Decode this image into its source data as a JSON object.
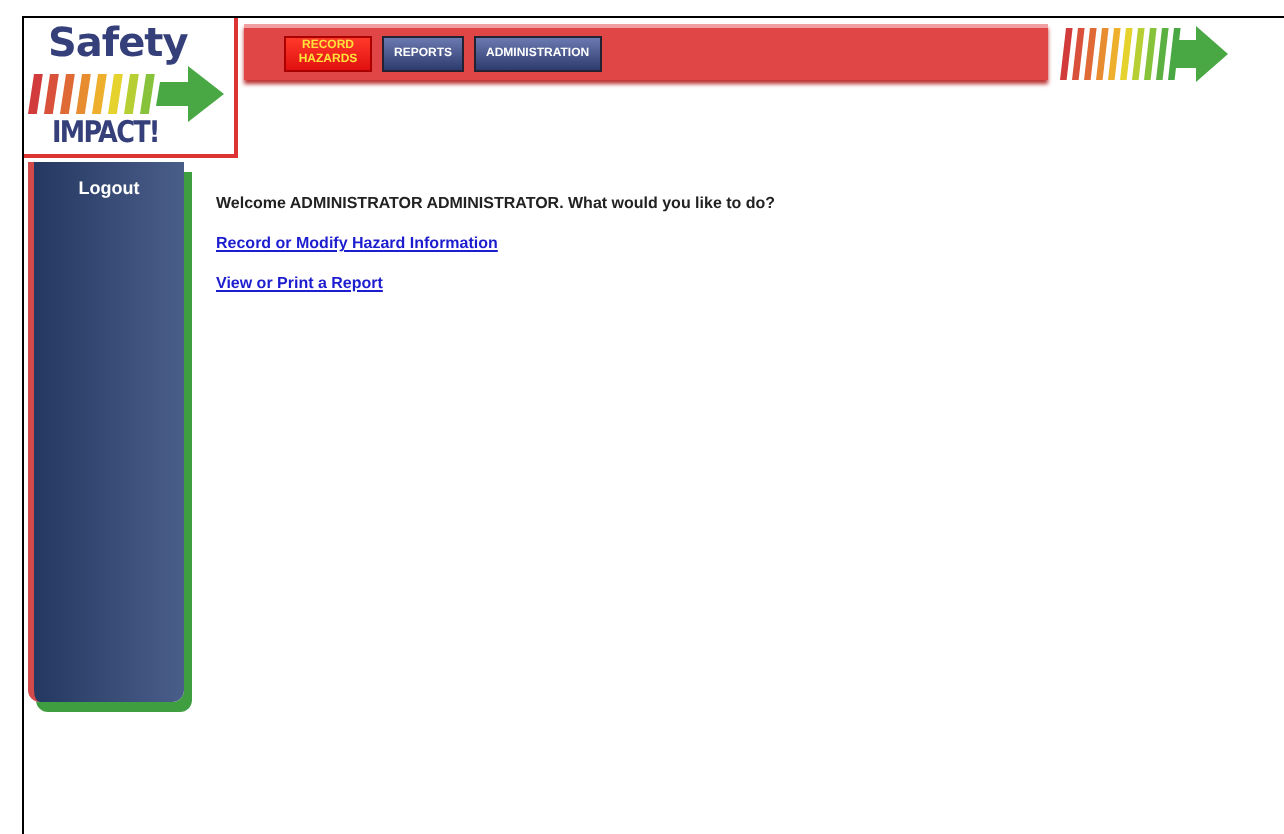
{
  "logo": {
    "top": "Safety",
    "bottom": "IMPACT!"
  },
  "tabs": [
    {
      "label": "RECORD HAZARDS",
      "selected": true
    },
    {
      "label": "REPORTS",
      "selected": false
    },
    {
      "label": "ADMINISTRATION",
      "selected": false
    }
  ],
  "sidebar": {
    "items": [
      "Logout"
    ]
  },
  "main": {
    "welcome": "Welcome ADMINISTRATOR ADMINISTRATOR. What would you like to do?",
    "links": [
      "Record or Modify Hazard Information",
      "View or Print a Report"
    ]
  }
}
